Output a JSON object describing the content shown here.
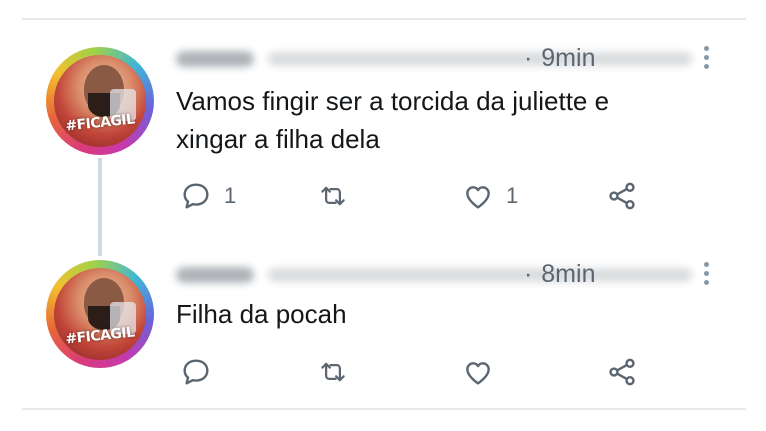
{
  "tweets": [
    {
      "avatar_text": "#FICAGIL",
      "time": "9min",
      "text_lines": [
        "Vamos fingir ser a torcida da juliette e",
        "xingar a filha dela"
      ],
      "reply_count": "1",
      "retweet_count": "",
      "like_count": "1"
    },
    {
      "avatar_text": "#FICAGIL",
      "time": "8min",
      "text_lines": [
        "Filha da pocah"
      ],
      "reply_count": "",
      "retweet_count": "",
      "like_count": ""
    }
  ],
  "separator": "·",
  "colors": {
    "text": "#14171a",
    "secondary": "#5b6671",
    "thread_line": "#cfd9de",
    "divider": "#e6e8ea"
  },
  "icons": [
    "reply-icon",
    "retweet-icon",
    "like-icon",
    "share-icon",
    "more-options-icon"
  ]
}
